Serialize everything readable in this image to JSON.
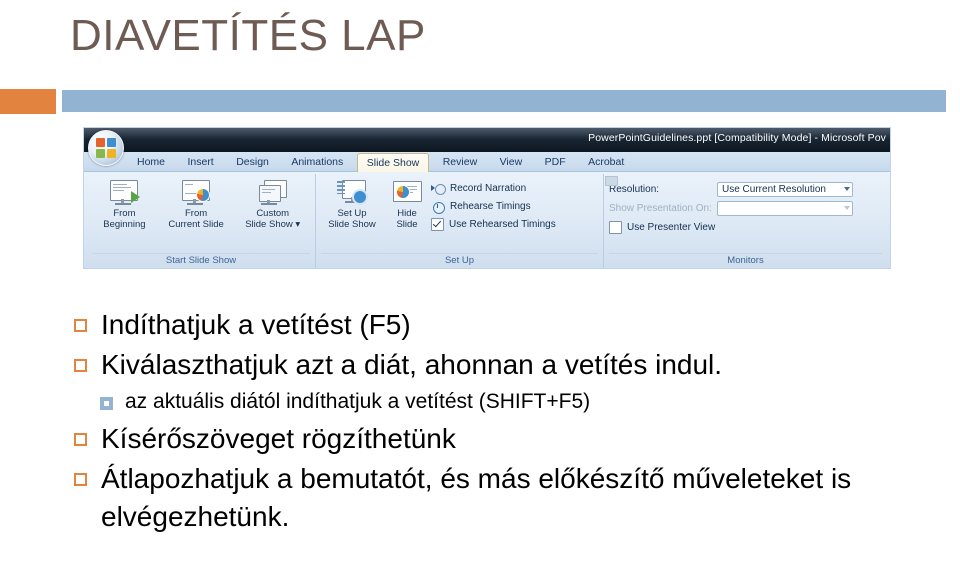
{
  "slide": {
    "title": "DIAVETÍTÉS LAP",
    "title_color": "#6E5B53",
    "accent_orange": "#E2833F",
    "accent_blue": "#93B3D3"
  },
  "ribbon_screenshot": {
    "titlebar": {
      "document_title": "PowerPointGuidelines.ppt [Compatibility Mode] - Microsoft Pov",
      "orb_name": "Office Button"
    },
    "tabs": [
      {
        "label": "Home",
        "active": false
      },
      {
        "label": "Insert",
        "active": false
      },
      {
        "label": "Design",
        "active": false
      },
      {
        "label": "Animations",
        "active": false
      },
      {
        "label": "Slide Show",
        "active": true
      },
      {
        "label": "Review",
        "active": false
      },
      {
        "label": "View",
        "active": false
      },
      {
        "label": "PDF",
        "active": false
      },
      {
        "label": "Acrobat",
        "active": false
      }
    ],
    "groups": [
      {
        "label": "Start Slide Show",
        "buttons": [
          {
            "line1": "From",
            "line2": "Beginning"
          },
          {
            "line1": "From",
            "line2": "Current Slide"
          },
          {
            "line1": "Custom",
            "line2": "Slide Show ▾"
          }
        ]
      },
      {
        "label": "Set Up",
        "buttons": [
          {
            "line1": "Set Up",
            "line2": "Slide Show"
          },
          {
            "line1": "Hide",
            "line2": "Slide"
          }
        ],
        "commands": [
          {
            "label": "Record Narration",
            "type": "icon",
            "disabled": false
          },
          {
            "label": "Rehearse Timings",
            "type": "icon",
            "disabled": false
          },
          {
            "label": "Use Rehearsed Timings",
            "type": "checkbox",
            "checked": true,
            "disabled": false
          }
        ]
      },
      {
        "label": "Monitors",
        "rows": [
          {
            "label": "Resolution:",
            "value": "Use Current Resolution",
            "disabled": false,
            "has_combo": true
          },
          {
            "label": "Show Presentation On:",
            "value": "",
            "disabled": true,
            "has_combo": true
          },
          {
            "label": "Use Presenter View",
            "type": "checkbox",
            "checked": false,
            "disabled": false,
            "has_combo": false
          }
        ]
      }
    ]
  },
  "bullets": [
    {
      "level": 1,
      "text": "Indíthatjuk a vetítést (F5)"
    },
    {
      "level": 1,
      "text": "Kiválaszthatjuk azt a diát, ahonnan a vetítés indul."
    },
    {
      "level": 2,
      "text": "az aktuális diától indíthatjuk a vetítést (SHIFT+F5)"
    },
    {
      "level": 1,
      "text": "Kísérőszöveget rögzíthetünk"
    },
    {
      "level": 1,
      "text": "Átlapozhatjuk a bemutatót, és más előkészítő műveleteket is elvégezhetünk."
    }
  ]
}
